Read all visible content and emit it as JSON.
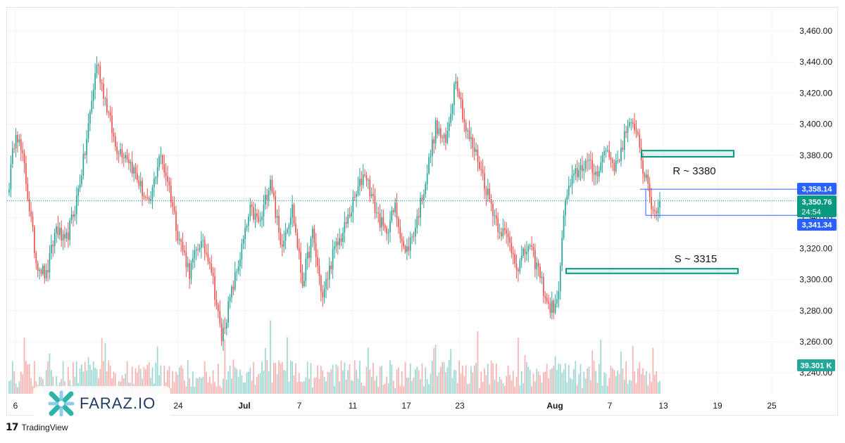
{
  "chart_data": {
    "type": "candlestick",
    "y_ticks": [
      "3,240.00",
      "3,260.00",
      "3,280.00",
      "3,300.00",
      "3,320.00",
      "3,340.00",
      "3,360.00",
      "3,380.00",
      "3,400.00",
      "3,420.00",
      "3,440.00",
      "3,460.00"
    ],
    "y_tick_values": [
      3240,
      3260,
      3280,
      3300,
      3320,
      3340,
      3360,
      3380,
      3400,
      3420,
      3440,
      3460
    ],
    "ylim": [
      3235,
      3470
    ],
    "x_ticks": [
      {
        "label": "6",
        "bold": false
      },
      {
        "label": "24",
        "bold": false
      },
      {
        "label": "Jul",
        "bold": true
      },
      {
        "label": "7",
        "bold": false
      },
      {
        "label": "11",
        "bold": false
      },
      {
        "label": "17",
        "bold": false
      },
      {
        "label": "23",
        "bold": false
      },
      {
        "label": "Aug",
        "bold": true
      },
      {
        "label": "7",
        "bold": false
      },
      {
        "label": "13",
        "bold": false
      },
      {
        "label": "19",
        "bold": false
      },
      {
        "label": "25",
        "bold": false
      }
    ],
    "anchors": [
      [
        0,
        3362
      ],
      [
        4,
        3398
      ],
      [
        9,
        3372
      ],
      [
        16,
        3312
      ],
      [
        22,
        3302
      ],
      [
        28,
        3334
      ],
      [
        33,
        3322
      ],
      [
        39,
        3346
      ],
      [
        45,
        3382
      ],
      [
        52,
        3440
      ],
      [
        57,
        3416
      ],
      [
        63,
        3386
      ],
      [
        70,
        3380
      ],
      [
        76,
        3365
      ],
      [
        83,
        3346
      ],
      [
        89,
        3380
      ],
      [
        94,
        3365
      ],
      [
        100,
        3330
      ],
      [
        107,
        3305
      ],
      [
        113,
        3324
      ],
      [
        119,
        3314
      ],
      [
        126,
        3262
      ],
      [
        131,
        3287
      ],
      [
        137,
        3315
      ],
      [
        143,
        3344
      ],
      [
        149,
        3336
      ],
      [
        155,
        3366
      ],
      [
        161,
        3322
      ],
      [
        168,
        3346
      ],
      [
        174,
        3298
      ],
      [
        180,
        3329
      ],
      [
        186,
        3288
      ],
      [
        192,
        3316
      ],
      [
        198,
        3330
      ],
      [
        205,
        3352
      ],
      [
        211,
        3370
      ],
      [
        217,
        3346
      ],
      [
        223,
        3330
      ],
      [
        229,
        3346
      ],
      [
        235,
        3316
      ],
      [
        241,
        3334
      ],
      [
        247,
        3364
      ],
      [
        253,
        3398
      ],
      [
        259,
        3387
      ],
      [
        265,
        3432
      ],
      [
        271,
        3396
      ],
      [
        278,
        3378
      ],
      [
        284,
        3355
      ],
      [
        290,
        3335
      ],
      [
        296,
        3326
      ],
      [
        302,
        3308
      ],
      [
        308,
        3322
      ],
      [
        314,
        3306
      ],
      [
        320,
        3282
      ],
      [
        325,
        3283
      ],
      [
        330,
        3352
      ],
      [
        336,
        3368
      ],
      [
        342,
        3376
      ],
      [
        348,
        3368
      ],
      [
        354,
        3384
      ],
      [
        360,
        3372
      ],
      [
        366,
        3396
      ],
      [
        372,
        3399
      ],
      [
        376,
        3372
      ],
      [
        382,
        3344
      ],
      [
        386,
        3347
      ]
    ],
    "last_price": 3350.76,
    "current_price_tag": "3,350.76",
    "countdown": "24:54",
    "box_top_tag": "3,358.14",
    "box_top_value": 3358.14,
    "box_bottom_tag": "3,341.34",
    "box_bottom_value": 3341.34,
    "volume_tag": "39.301 K",
    "resistance": {
      "label": "R ~ 3380",
      "low": 3379,
      "high": 3383
    },
    "support": {
      "label": "S ~ 3315",
      "low": 3304,
      "high": 3307
    },
    "up_color": "#26a69a",
    "down_color": "#ef5350",
    "accent_color": "#2962ff"
  },
  "branding": {
    "platform": "TradingView",
    "watermark": "FARAZ.IO"
  }
}
